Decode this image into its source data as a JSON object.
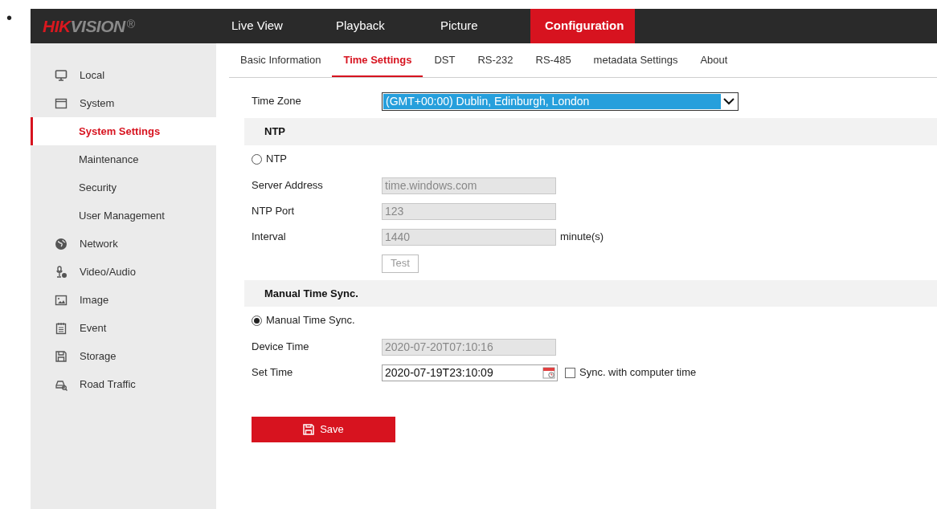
{
  "bullet": "•",
  "logo": {
    "red_part": "HIK",
    "gray_part": "VISION",
    "mark": "®"
  },
  "nav": [
    {
      "label": "Live View",
      "selected": false
    },
    {
      "label": "Playback",
      "selected": false
    },
    {
      "label": "Picture",
      "selected": false
    },
    {
      "label": "Configuration",
      "selected": true
    }
  ],
  "sidebar": {
    "items": [
      {
        "label": "Local",
        "selected": false
      },
      {
        "label": "System",
        "selected": false,
        "children": [
          {
            "label": "System Settings",
            "selected": true
          },
          {
            "label": "Maintenance",
            "selected": false
          },
          {
            "label": "Security",
            "selected": false
          },
          {
            "label": "User Management",
            "selected": false
          }
        ]
      },
      {
        "label": "Network",
        "selected": false
      },
      {
        "label": "Video/Audio",
        "selected": false
      },
      {
        "label": "Image",
        "selected": false
      },
      {
        "label": "Event",
        "selected": false
      },
      {
        "label": "Storage",
        "selected": false
      },
      {
        "label": "Road Traffic",
        "selected": false
      }
    ]
  },
  "tabs": [
    {
      "label": "Basic Information",
      "selected": false
    },
    {
      "label": "Time Settings",
      "selected": true
    },
    {
      "label": "DST",
      "selected": false
    },
    {
      "label": "RS-232",
      "selected": false
    },
    {
      "label": "RS-485",
      "selected": false
    },
    {
      "label": "metadata Settings",
      "selected": false
    },
    {
      "label": "About",
      "selected": false
    }
  ],
  "time_zone": {
    "label": "Time Zone",
    "value": "(GMT+00:00) Dublin, Edinburgh, London"
  },
  "ntp": {
    "heading": "NTP",
    "radio": {
      "label": "NTP",
      "selected": false
    },
    "fields": [
      {
        "label": "Server Address",
        "value": "time.windows.com",
        "disabled": true
      },
      {
        "label": "NTP Port",
        "value": "123",
        "disabled": true
      },
      {
        "label": "Interval",
        "value": "1440",
        "disabled": true,
        "unit": "minute(s)"
      }
    ],
    "test_button": {
      "label": "Test",
      "disabled": true
    }
  },
  "manual": {
    "heading": "Manual Time Sync.",
    "radio": {
      "label": "Manual Time Sync.",
      "selected": true
    },
    "device_time": {
      "label": "Device Time",
      "value": "2020-07-20T07:10:16",
      "disabled": true
    },
    "set_time": {
      "label": "Set Time",
      "value": "2020-07-19T23:10:09",
      "disabled": false
    },
    "sync_checkbox": {
      "label": "Sync. with computer time",
      "checked": false
    }
  },
  "save_button": {
    "label": "Save"
  }
}
